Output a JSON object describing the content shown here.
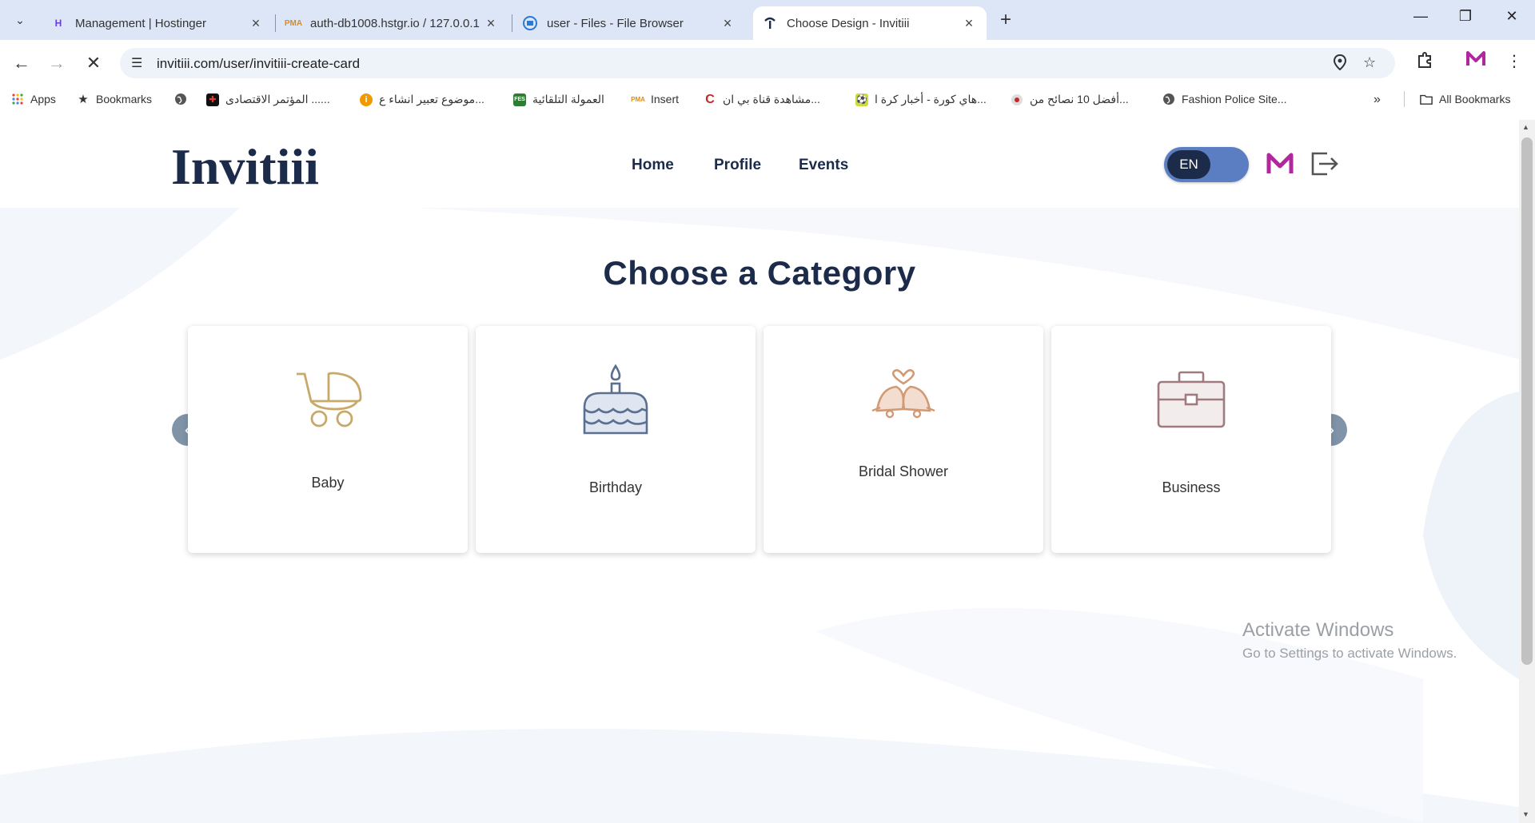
{
  "browser": {
    "tabs": [
      {
        "title": "Management | Hostinger",
        "favicon": "hostinger-icon"
      },
      {
        "title": "auth-db1008.hstgr.io / 127.0.0.1",
        "favicon": "phpmyadmin-icon"
      },
      {
        "title": "user - Files - File Browser",
        "favicon": "filebrowser-icon"
      },
      {
        "title": "Choose Design - Invitiii",
        "favicon": "invitiii-icon"
      }
    ],
    "address_bar": {
      "url": "invitiii.com/user/invitiii-create-card"
    },
    "bookmarks": [
      {
        "label": "Apps",
        "icon": "apps-grid-icon"
      },
      {
        "label": "Bookmarks",
        "icon": "star-icon"
      },
      {
        "label": "",
        "icon": "globe-icon"
      },
      {
        "label": "المؤتمر الاقتصادى ......",
        "icon": "news-icon"
      },
      {
        "label": "موضوع تعبير انشاء ع...",
        "icon": "info-icon"
      },
      {
        "label": "العمولة التلقائية",
        "icon": "fes-icon"
      },
      {
        "label": "Insert",
        "icon": "phpmyadmin-icon"
      },
      {
        "label": "مشاهدة قناة بي ان...",
        "icon": "c-icon"
      },
      {
        "label": "هاي كورة - أخبار كرة ا...",
        "icon": "soccer-icon"
      },
      {
        "label": "أفضل 10 نصائح من...",
        "icon": "record-icon"
      },
      {
        "label": "Fashion Police Site...",
        "icon": "globe-icon"
      }
    ],
    "all_bookmarks": "All Bookmarks"
  },
  "site": {
    "logo_text": "Invitiii",
    "nav": [
      {
        "label": "Home"
      },
      {
        "label": "Profile"
      },
      {
        "label": "Events"
      }
    ],
    "language": "EN"
  },
  "main": {
    "title": "Choose a Category",
    "categories": [
      {
        "label": "Baby",
        "icon": "baby-stroller-icon",
        "color": "#c9a96a"
      },
      {
        "label": "Birthday",
        "icon": "birthday-cake-icon",
        "color": "#5b6f8f"
      },
      {
        "label": "Bridal Shower",
        "icon": "wedding-bells-icon",
        "color": "#d29a74"
      },
      {
        "label": "Business",
        "icon": "briefcase-icon",
        "color": "#a07a7e"
      }
    ]
  },
  "watermark": {
    "line1": "Activate Windows",
    "line2": "Go to Settings to activate Windows."
  },
  "colors": {
    "brand_navy": "#1c2b4a",
    "toggle_blue": "#5b7dc1",
    "brand_magenta": "#b0279e",
    "tabbar_bg": "#dde6f6"
  }
}
